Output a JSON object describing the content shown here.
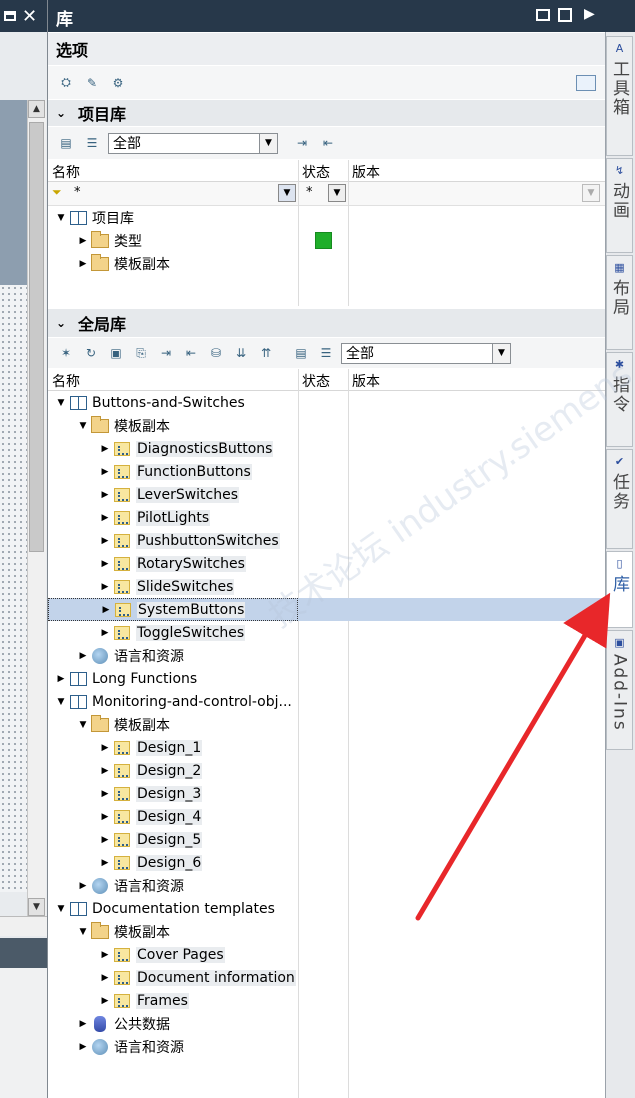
{
  "panel": {
    "title": "库",
    "collapse_icon": "tile-icon",
    "dock_icon": "dock-icon",
    "pin_icon": "arrow-right-icon"
  },
  "options": {
    "title": "选项"
  },
  "project_library": {
    "title": "项目库",
    "filter_value": "全部",
    "columns": {
      "name": "名称",
      "status": "状态",
      "version": "版本"
    },
    "filter_row": {
      "name": "*",
      "status": "*"
    },
    "tree": [
      {
        "label": "项目库",
        "level": 0,
        "expanded": true,
        "icon": "book-icon"
      },
      {
        "label": "类型",
        "level": 1,
        "expanded": false,
        "icon": "folder-icon",
        "status_color": "#1fae2a"
      },
      {
        "label": "模板副本",
        "level": 1,
        "expanded": false,
        "icon": "folder-icon"
      }
    ]
  },
  "global_library": {
    "title": "全局库",
    "filter_value": "全部",
    "columns": {
      "name": "名称",
      "status": "状态",
      "version": "版本"
    },
    "tree": [
      {
        "label": "Buttons-and-Switches",
        "level": 0,
        "expanded": true,
        "icon": "book-icon"
      },
      {
        "label": "模板副本",
        "level": 1,
        "expanded": true,
        "icon": "folder-icon"
      },
      {
        "label": "DiagnosticsButtons",
        "level": 2,
        "icon": "library-folder-icon"
      },
      {
        "label": "FunctionButtons",
        "level": 2,
        "icon": "library-folder-icon"
      },
      {
        "label": "LeverSwitches",
        "level": 2,
        "icon": "library-folder-icon"
      },
      {
        "label": "PilotLights",
        "level": 2,
        "icon": "library-folder-icon"
      },
      {
        "label": "PushbuttonSwitches",
        "level": 2,
        "icon": "library-folder-icon"
      },
      {
        "label": "RotarySwitches",
        "level": 2,
        "icon": "library-folder-icon"
      },
      {
        "label": "SlideSwitches",
        "level": 2,
        "icon": "library-folder-icon"
      },
      {
        "label": "SystemButtons",
        "level": 2,
        "icon": "library-folder-icon",
        "selected": true
      },
      {
        "label": "ToggleSwitches",
        "level": 2,
        "icon": "library-folder-icon"
      },
      {
        "label": "语言和资源",
        "level": 1,
        "icon": "globe-icon"
      },
      {
        "label": "Long Functions",
        "level": 0,
        "expanded": false,
        "icon": "book-icon"
      },
      {
        "label": "Monitoring-and-control-obj...",
        "level": 0,
        "expanded": true,
        "icon": "book-icon"
      },
      {
        "label": "模板副本",
        "level": 1,
        "expanded": true,
        "icon": "folder-icon"
      },
      {
        "label": "Design_1",
        "level": 2,
        "icon": "library-folder-icon"
      },
      {
        "label": "Design_2",
        "level": 2,
        "icon": "library-folder-icon"
      },
      {
        "label": "Design_3",
        "level": 2,
        "icon": "library-folder-icon"
      },
      {
        "label": "Design_4",
        "level": 2,
        "icon": "library-folder-icon"
      },
      {
        "label": "Design_5",
        "level": 2,
        "icon": "library-folder-icon"
      },
      {
        "label": "Design_6",
        "level": 2,
        "icon": "library-folder-icon"
      },
      {
        "label": "语言和资源",
        "level": 1,
        "icon": "globe-icon"
      },
      {
        "label": "Documentation templates",
        "level": 0,
        "expanded": true,
        "icon": "book-icon"
      },
      {
        "label": "模板副本",
        "level": 1,
        "expanded": true,
        "icon": "folder-icon"
      },
      {
        "label": "Cover Pages",
        "level": 2,
        "icon": "library-folder-icon"
      },
      {
        "label": "Document information",
        "level": 2,
        "icon": "library-folder-icon"
      },
      {
        "label": "Frames",
        "level": 2,
        "icon": "library-folder-icon"
      },
      {
        "label": "公共数据",
        "level": 1,
        "icon": "database-icon"
      },
      {
        "label": "语言和资源",
        "level": 1,
        "icon": "globe-icon"
      }
    ]
  },
  "right_tabs": [
    {
      "label": "工具箱",
      "icon": "tools-icon"
    },
    {
      "label": "动画",
      "icon": "animation-icon"
    },
    {
      "label": "布局",
      "icon": "layout-icon"
    },
    {
      "label": "指令",
      "icon": "instruction-icon"
    },
    {
      "label": "任务",
      "icon": "task-icon"
    },
    {
      "label": "库",
      "icon": "library-icon",
      "active": true
    },
    {
      "label": "Add-Ins",
      "icon": "addins-icon"
    }
  ],
  "watermark": "技术论坛 industry.siemens.com/cs",
  "annotation": {
    "color": "#e8272a"
  }
}
